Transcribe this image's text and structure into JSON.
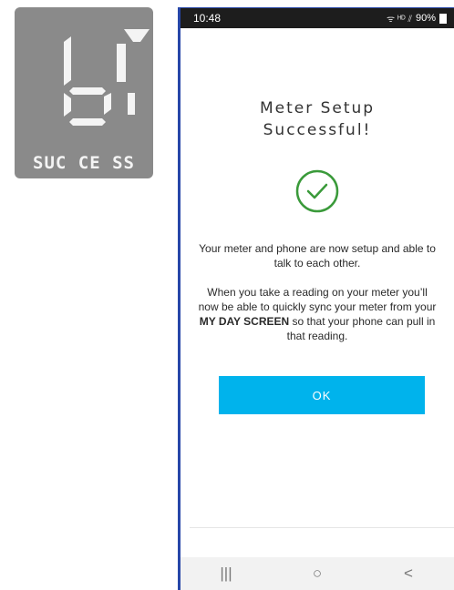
{
  "meter": {
    "digits": "b7",
    "status_text": "SUC CE SS"
  },
  "status_bar": {
    "time": "10:48",
    "signal_icons": "ᯤ ᴴᴰ ⫽",
    "battery": "90%"
  },
  "screen": {
    "title_line1": "Meter Setup",
    "title_line2": "Successful!",
    "paragraph1": "Your meter and phone are now setup and able to talk to each other.",
    "paragraph2_part1": "When you take a reading on your meter you’ll now be able to quickly sync your meter from your ",
    "paragraph2_bold": "MY DAY SCREEN",
    "paragraph2_part2": " so that your phone can pull in that reading.",
    "ok_label": "OK"
  },
  "navbar": {
    "recents_glyph": "|||",
    "home_glyph": "○",
    "back_glyph": "<"
  },
  "colors": {
    "accent": "#00b3ec",
    "check": "#3a9a3a",
    "lcd_bg": "#8a8a8a",
    "frame": "#2747a8"
  }
}
